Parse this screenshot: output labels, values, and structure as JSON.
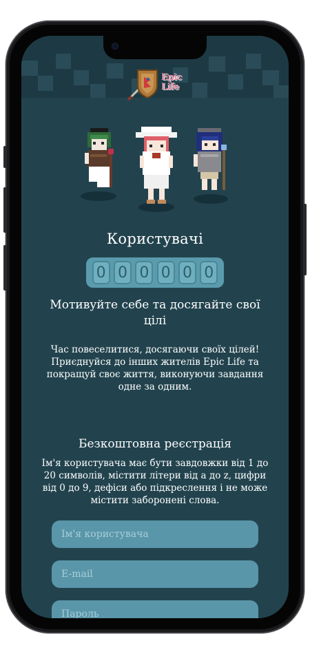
{
  "app": {
    "logo_line1": "Epic",
    "logo_line2": "Life",
    "colors": {
      "background": "#22434e",
      "accent": "#e8557a",
      "field": "#5a96a9",
      "counter": "#5a9cad"
    }
  },
  "stats": {
    "title": "Користувачі",
    "counter_digits": [
      "0",
      "0",
      "0",
      "0",
      "0",
      "0"
    ]
  },
  "intro": {
    "heading": "Мотивуйте себе та досягайте свої цілі",
    "body": "Час повеселитися, досягаючи своїх цілей! Приєднуйся до інших жителів Epic Life та покращуй своє життя, виконуючи завдання одне за одним."
  },
  "registration": {
    "title": "Безкоштовна реєстрація",
    "rules": "Ім'я користувача має бути завдовжки від 1 до 20 символів, містити літери від a до z, цифри від 0 до 9, дефіси або підкреслення і не може містити заборонені слова.",
    "username_placeholder": "Ім'я користувача",
    "email_placeholder": "E-mail",
    "password_placeholder": "Пароль"
  }
}
